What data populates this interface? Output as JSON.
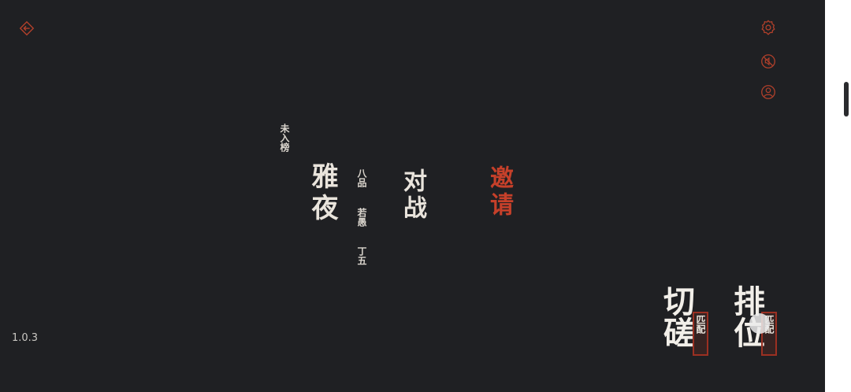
{
  "icons": {
    "back": "back-arrow-icon",
    "settings": "gear-icon",
    "mute": "sound-off-icon",
    "profile": "user-icon"
  },
  "colors": {
    "background": "#1f2023",
    "accent": "#c6402a",
    "text": "#e9e4dc"
  },
  "rank": {
    "status": "未入榜",
    "name": "雅夜",
    "grade": "八品",
    "title": "若愚",
    "stage": "丁五"
  },
  "menu": {
    "battle": "对战",
    "invite": "邀请"
  },
  "version": "1.0.3",
  "modes": {
    "casual": {
      "label": "切磋",
      "tag": "匹配"
    },
    "ranked": {
      "label": "排位",
      "tag": "匹配"
    }
  }
}
